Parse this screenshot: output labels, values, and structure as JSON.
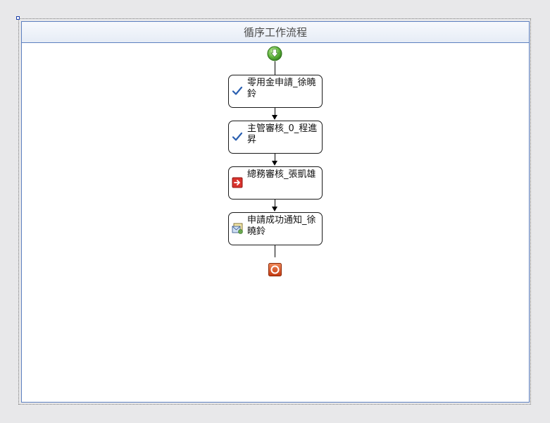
{
  "workflow": {
    "title": "循序工作流程"
  },
  "activities": [
    {
      "label": "零用金申請_徐曉鈴",
      "icon": "checkmark-icon"
    },
    {
      "label": "主管審核_0_程進昇",
      "icon": "checkmark-icon"
    },
    {
      "label": "總務審核_張凱雄",
      "icon": "red-arrow-icon"
    },
    {
      "label": "申請成功通知_徐曉鈴",
      "icon": "email-notification-icon"
    }
  ],
  "colors": {
    "panel_border": "#5d80c0",
    "start_green": "#5fb33a",
    "end_red": "#d84a1b",
    "check_blue": "#2a5fb0"
  }
}
